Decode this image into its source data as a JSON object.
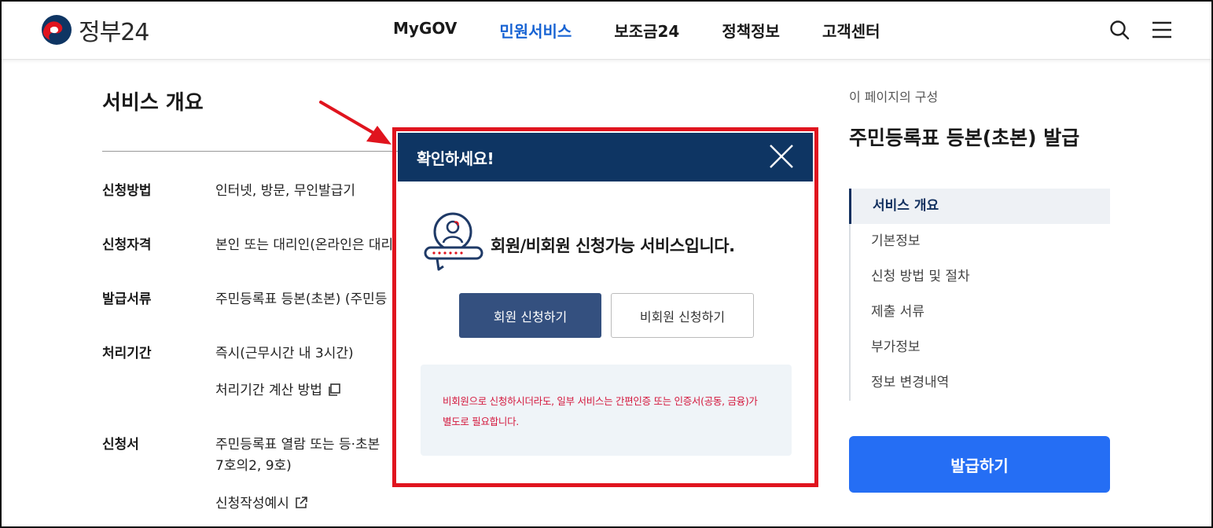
{
  "header": {
    "logo_text": "정부24",
    "nav": [
      "MyGOV",
      "민원서비스",
      "보조금24",
      "정책정보",
      "고객센터"
    ],
    "active_nav_index": 1,
    "icons": [
      "search-icon",
      "hamburger-menu-icon"
    ]
  },
  "main": {
    "section_title": "서비스 개요",
    "rows": [
      {
        "label": "신청방법",
        "value": "인터넷, 방문, 무인발급기"
      },
      {
        "label": "신청자격",
        "value": "본인 또는 대리인(온라인은 대리"
      },
      {
        "label": "발급서류",
        "value": "주민등록표 등본(초본) (주민등"
      },
      {
        "label": "처리기간",
        "value": "즉시(근무시간 내 3시간)"
      },
      {
        "label": "",
        "value": "처리기간 계산 방법"
      },
      {
        "label": "신청서",
        "value": "주민등록표 열람 또는 등·초본"
      },
      {
        "label": "",
        "value": "7호의2, 9호)"
      },
      {
        "label": "",
        "value": "신청작성예시"
      }
    ]
  },
  "sidebar": {
    "caption": "이 페이지의 구성",
    "title": "주민등록표 등본(초본) 발급",
    "items": [
      "서비스 개요",
      "기본정보",
      "신청 방법 및 절차",
      "제출 서류",
      "부가정보",
      "정보 변경내역"
    ],
    "active_index": 0,
    "issue_button": "발급하기"
  },
  "modal": {
    "title": "확인하세요!",
    "message": "회원/비회원 신청가능 서비스입니다.",
    "member_button": "회원 신청하기",
    "guest_button": "비회원 신청하기",
    "notice_line1": "비회원으로 신청하시더라도, 일부 서비스는 간편인증 또는 인증서(공동, 금융)가",
    "notice_line2": "별도로 필요합니다."
  },
  "colors": {
    "brand_navy": "#0e3563",
    "active_nav": "#1763d3",
    "primary_button": "#256ef4",
    "member_button": "#34507f",
    "highlight_red": "#e0141e",
    "notice_text": "#d4193e"
  }
}
